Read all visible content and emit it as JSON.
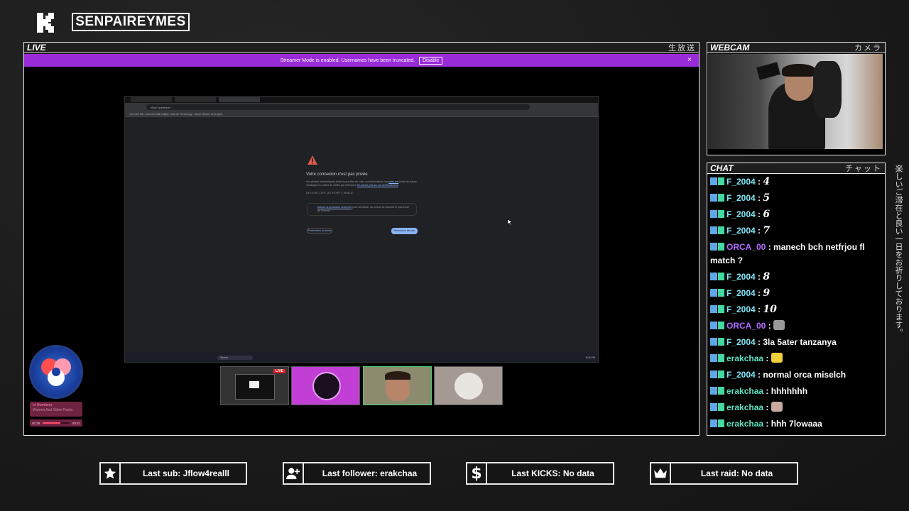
{
  "header": {
    "channel_name": "SENPAIREYMES"
  },
  "live_panel": {
    "title": "LIVE",
    "jp": "生放送"
  },
  "webcam_panel": {
    "title": "WEBCAM",
    "jp": "カメラ"
  },
  "chat_panel": {
    "title": "CHAT",
    "jp": "チャット"
  },
  "streamer_banner": {
    "text": "Streamer Mode is enabled. Usernames have been truncated.",
    "button": "Disable",
    "close": "×"
  },
  "browser": {
    "tabs": [
      "",
      ""
    ],
    "url": "https://patrbaret",
    "bookmarks": "YouTube  Mis...antenna  Mail  Cuttiple  Links de Personnag...  Msxar  Moraes de la quée",
    "error_title": "Votre connexion n'est pas privée",
    "error_body_1": "Des pirates informatiques tentent peut-être de voler vos informations sur",
    "error_body_link": "patrb.net",
    "error_body_2": "(mots de passe, messages ou cartes de crédit, par exemple).",
    "error_link_more": "En savoir plus sur cet avertissement",
    "error_code": "NET::ERR_CERT_AUTHORITY_INVALID",
    "box_link": "Activez la protection renforcée",
    "box_text": "pour bénéficier du niveau de sécurité le plus élevé de Chrome",
    "advanced_button": "Paramètres avancés",
    "back_button": "Revenir en lieu sûr",
    "taskbar_search": "Search",
    "taskbar_time": "8:05 PM",
    "taskbar_left": "Tabs plus froid\nSunnyvale"
  },
  "thumb_live_label": "LIVE",
  "music": {
    "title": "In Numbers",
    "artist": "Women And Other Points",
    "elapsed": "00:38",
    "total": "00:57",
    "progress": 0.67
  },
  "chat": [
    {
      "user": "F_2004",
      "color": "blue",
      "text": "4",
      "big": true
    },
    {
      "user": "F_2004",
      "color": "blue",
      "text": "5",
      "big": true
    },
    {
      "user": "F_2004",
      "color": "blue",
      "text": "6",
      "big": true
    },
    {
      "user": "F_2004",
      "color": "blue",
      "text": "7",
      "big": true
    },
    {
      "user": "ORCA_00",
      "color": "purple",
      "text": "manech bch netfrjou fl match ?"
    },
    {
      "user": "F_2004",
      "color": "blue",
      "text": "8",
      "big": true
    },
    {
      "user": "F_2004",
      "color": "blue",
      "text": "9",
      "big": true
    },
    {
      "user": "F_2004",
      "color": "blue",
      "text": "10",
      "big": true
    },
    {
      "user": "ORCA_00",
      "color": "purple",
      "text": "",
      "emote": "cat-emote"
    },
    {
      "user": "F_2004",
      "color": "blue",
      "text": "3la 5ater tanzanya"
    },
    {
      "user": "erakchaa",
      "color": "green",
      "text": "",
      "emote": "duck-emote"
    },
    {
      "user": "F_2004",
      "color": "blue",
      "text": "normal orca miselch"
    },
    {
      "user": "erakchaa",
      "color": "green",
      "text": "hhhhhhh"
    },
    {
      "user": "erakchaa",
      "color": "green",
      "text": "",
      "emote": "hamster-emote"
    },
    {
      "user": "erakchaa",
      "color": "green",
      "text": "hhh 7lowaaa"
    }
  ],
  "side_text": "楽しいご滞在と良い一日をお祈りしております。",
  "stats": {
    "sub": "Last sub: Jflow4realll",
    "follower": "Last follower: erakchaa",
    "kicks": "Last KICKS: No data",
    "raid": "Last raid: No data"
  },
  "colors": {
    "accent_purple": "#9a2bd9",
    "chat_blue": "#7ee5f5",
    "chat_purple": "#b06cff",
    "chat_green": "#5fe0c2",
    "live_red": "#e0202a"
  }
}
